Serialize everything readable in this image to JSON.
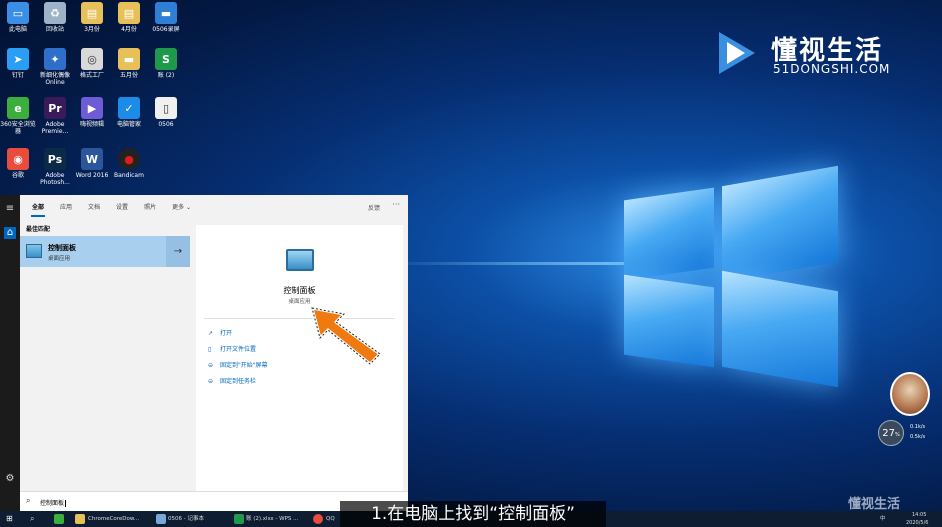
{
  "desktop": {
    "icons": [
      {
        "label": "此电脑",
        "icon": "computer-icon",
        "color": "#3a8ee6"
      },
      {
        "label": "回收站",
        "icon": "recycle-bin-icon",
        "color": "#9fb3c8"
      },
      {
        "label": "3月份",
        "icon": "folder-zip-icon",
        "color": "#e8c05a"
      },
      {
        "label": "4月份",
        "icon": "folder-zip-icon",
        "color": "#e8c05a"
      },
      {
        "label": "0506录屏",
        "icon": "folder-icon",
        "color": "#2f7fd6"
      },
      {
        "label": "钉钉",
        "icon": "dingtalk-icon",
        "color": "#2a9df4"
      },
      {
        "label": "新细化偶像 Online",
        "icon": "app-icon",
        "color": "#2f6fc9"
      },
      {
        "label": "格式工厂",
        "icon": "format-factory-icon",
        "color": "#d9d9d9"
      },
      {
        "label": "五月份",
        "icon": "folder-icon",
        "color": "#e8c05a"
      },
      {
        "label": "账 (2)",
        "icon": "spreadsheet-icon",
        "color": "#1f9a4c"
      },
      {
        "label": "360安全浏览器",
        "icon": "browser-360-icon",
        "color": "#3cae3c"
      },
      {
        "label": "Adobe Premie...",
        "icon": "premiere-icon",
        "color": "#3b1a5a"
      },
      {
        "label": "嗨视频辑",
        "icon": "video-editor-icon",
        "color": "#6e5bd6"
      },
      {
        "label": "电脑管家",
        "icon": "shield-icon",
        "color": "#1c8ce8"
      },
      {
        "label": "0506",
        "icon": "document-icon",
        "color": "#f0f0f0"
      },
      {
        "label": "谷歌",
        "icon": "chrome-icon",
        "color": "#e74c3c"
      },
      {
        "label": "Adobe Photosh...",
        "icon": "photoshop-icon",
        "color": "#0b2a45"
      },
      {
        "label": "Word 2016",
        "icon": "word-icon",
        "color": "#2b579a"
      },
      {
        "label": "Bandicam",
        "icon": "bandicam-icon",
        "color": "#222222"
      }
    ]
  },
  "brand": {
    "name": "懂视生活",
    "sub": "51DONGSHI.COM"
  },
  "search_panel": {
    "tabs": [
      "全部",
      "应用",
      "文档",
      "设置",
      "照片",
      "更多"
    ],
    "feedback": "反馈",
    "more": "···",
    "section_title": "最佳匹配",
    "best_match": {
      "title": "控制面板",
      "subtitle": "桌面应用"
    },
    "detail": {
      "title": "控制面板",
      "subtitle": "桌面应用"
    },
    "actions": [
      "打开",
      "打开文件位置",
      "固定到\"开始\"屏幕",
      "固定到任务栏"
    ],
    "query": "控制面板"
  },
  "caption": "1.在电脑上找到“控制面板”",
  "taskbar": {
    "items": [
      "ChromeCoreDow...",
      "0506 - 记事本",
      "账 (2).xlsx - WPS ...",
      "QQ"
    ],
    "clock_time": "14:05",
    "clock_date": "2020/5/6",
    "ime": "中"
  },
  "widget": {
    "speed": "27",
    "speed_unit": "%",
    "up": "0.1k/s",
    "down": "0.5k/s"
  },
  "watermark": "懂视生活"
}
